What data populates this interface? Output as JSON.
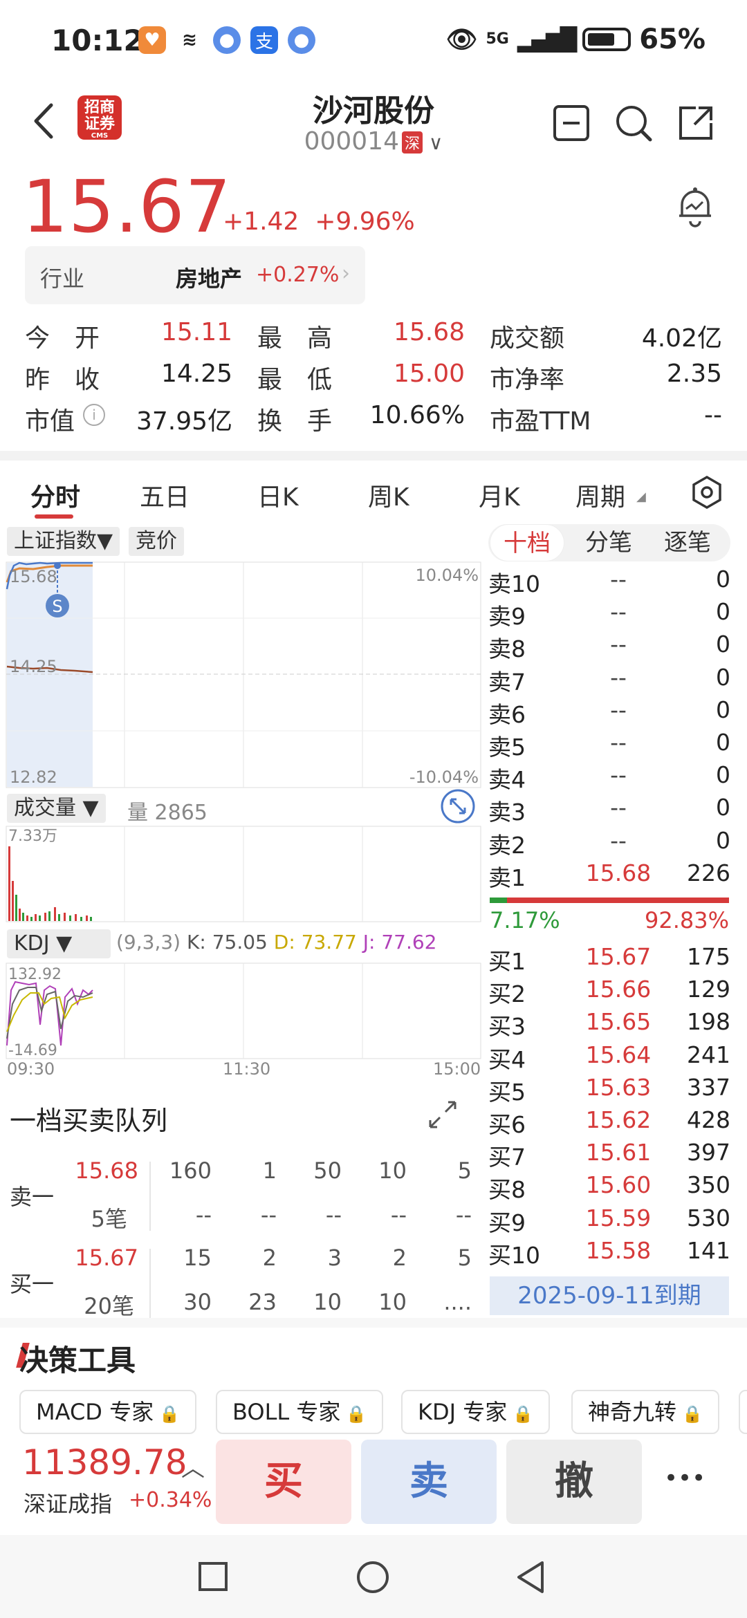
{
  "status_bar": {
    "time": "10:12",
    "battery": "65%",
    "network": "5G"
  },
  "header": {
    "name": "沙河股份",
    "code": "000014",
    "exchange": "深",
    "logo_text": "招商证券",
    "logo_sub": "CMS"
  },
  "quote": {
    "price": "15.67",
    "change": "+1.42",
    "change_pct": "+9.96%"
  },
  "industry": {
    "label": "行业",
    "name": "房地产",
    "change": "+0.27%"
  },
  "stats": [
    {
      "label": "今　开",
      "value": "15.11",
      "color": "red"
    },
    {
      "label": "最　高",
      "value": "15.68",
      "color": "red"
    },
    {
      "label": "成交额",
      "value": "4.02亿",
      "color": "dark"
    },
    {
      "label": "昨　收",
      "value": "14.25",
      "color": "dark"
    },
    {
      "label": "最　低",
      "value": "15.00",
      "color": "red"
    },
    {
      "label": "市净率",
      "value": "2.35",
      "color": "dark"
    },
    {
      "label": "市值",
      "value": "37.95亿",
      "color": "dark"
    },
    {
      "label": "换　手",
      "value": "10.66%",
      "color": "dark"
    },
    {
      "label": "市盈TTM",
      "value": "--",
      "color": "dark"
    }
  ],
  "tabs": [
    "分时",
    "五日",
    "日K",
    "周K",
    "月K",
    "周期"
  ],
  "chart": {
    "index_chip": "上证指数▼",
    "auction_chip": "竞价",
    "y_high": "15.68",
    "y_mid": "14.25",
    "y_low": "12.82",
    "pct_high": "10.04%",
    "pct_low": "-10.04%",
    "marker": "S",
    "volume_chip": "成交量 ▼",
    "volume_label": "量 2865",
    "volume_max": "7.33万",
    "kdj_chip": "KDJ ▼",
    "kdj_params": "(9,3,3)",
    "kdj_k": "K: 75.05",
    "kdj_d": "D: 73.77",
    "kdj_j": "J: 77.62",
    "kdj_high": "132.92",
    "kdj_low": "-14.69",
    "time_start": "09:30",
    "time_mid": "11:30",
    "time_end": "15:00"
  },
  "orderbook": {
    "tabs": [
      "十档",
      "分笔",
      "逐笔"
    ],
    "asks": [
      {
        "n": "卖10",
        "p": "--",
        "v": "0"
      },
      {
        "n": "卖9",
        "p": "--",
        "v": "0"
      },
      {
        "n": "卖8",
        "p": "--",
        "v": "0"
      },
      {
        "n": "卖7",
        "p": "--",
        "v": "0"
      },
      {
        "n": "卖6",
        "p": "--",
        "v": "0"
      },
      {
        "n": "卖5",
        "p": "--",
        "v": "0"
      },
      {
        "n": "卖4",
        "p": "--",
        "v": "0"
      },
      {
        "n": "卖3",
        "p": "--",
        "v": "0"
      },
      {
        "n": "卖2",
        "p": "--",
        "v": "0"
      },
      {
        "n": "卖1",
        "p": "15.68",
        "v": "226"
      }
    ],
    "ratio_sell": "7.17%",
    "ratio_buy": "92.83%",
    "ratio_sell_fraction": 0.0717,
    "bids": [
      {
        "n": "买1",
        "p": "15.67",
        "v": "175"
      },
      {
        "n": "买2",
        "p": "15.66",
        "v": "129"
      },
      {
        "n": "买3",
        "p": "15.65",
        "v": "198"
      },
      {
        "n": "买4",
        "p": "15.64",
        "v": "241"
      },
      {
        "n": "买5",
        "p": "15.63",
        "v": "337"
      },
      {
        "n": "买6",
        "p": "15.62",
        "v": "428"
      },
      {
        "n": "买7",
        "p": "15.61",
        "v": "397"
      },
      {
        "n": "买8",
        "p": "15.60",
        "v": "350"
      },
      {
        "n": "买9",
        "p": "15.59",
        "v": "530"
      },
      {
        "n": "买10",
        "p": "15.58",
        "v": "141"
      }
    ],
    "expiry": "2025-09-11到期"
  },
  "queue": {
    "title": "一档买卖队列",
    "sell_label": "卖一",
    "sell_price": "15.68",
    "sell_count": "5笔",
    "sell_row1": [
      "160",
      "1",
      "50",
      "10",
      "5"
    ],
    "sell_row2": [
      "--",
      "--",
      "--",
      "--",
      "--"
    ],
    "buy_label": "买一",
    "buy_price": "15.67",
    "buy_count": "20笔",
    "buy_row1": [
      "15",
      "2",
      "3",
      "2",
      "5"
    ],
    "buy_row2": [
      "30",
      "23",
      "10",
      "10",
      "...."
    ]
  },
  "tools": {
    "title": "决策工具",
    "items": [
      "MACD 专家",
      "BOLL 专家",
      "KDJ 专家",
      "神奇九转"
    ]
  },
  "bottom": {
    "index_value": "11389.78",
    "index_name": "深证成指",
    "index_change": "+0.34%",
    "buy": "买",
    "sell": "卖",
    "cancel": "撤",
    "more": "•••"
  }
}
